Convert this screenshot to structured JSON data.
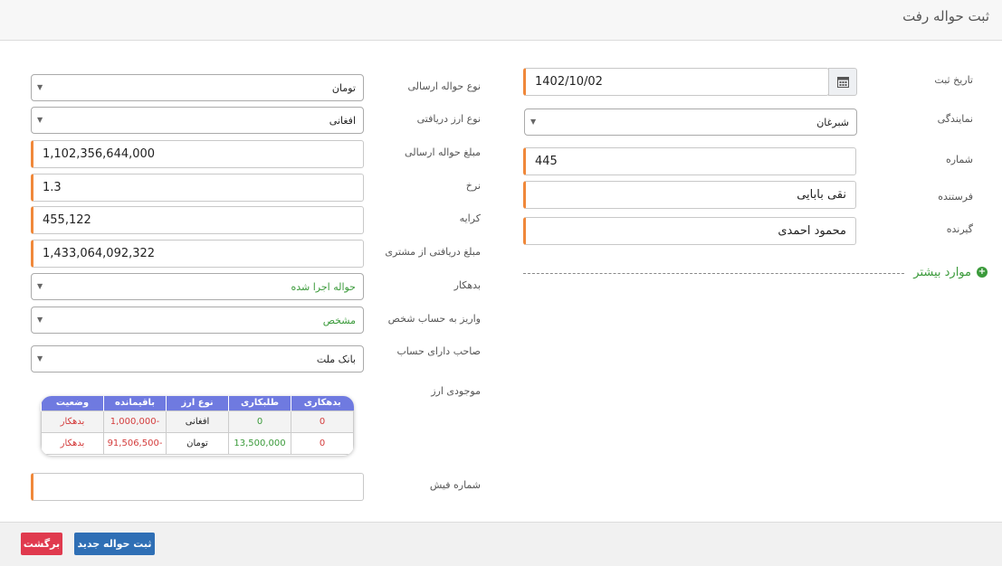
{
  "header": {
    "title": "ثبت حواله رفت"
  },
  "right_form": {
    "reg_date": {
      "label": "تاریخ ثبت",
      "value": "1402/10/02"
    },
    "agency": {
      "label": "نمایندگی",
      "value": "شبرغان"
    },
    "number": {
      "label": "شماره",
      "value": "445"
    },
    "sender": {
      "label": "فرستنده",
      "value": "نقی بابایی"
    },
    "receiver": {
      "label": "گیرنده",
      "value": "محمود احمدی"
    },
    "more_label": "موارد بیشتر"
  },
  "left_form": {
    "send_type": {
      "label": "نوع حواله ارسالی",
      "value": "تومان"
    },
    "recv_currency": {
      "label": "نوع ارز دریافتی",
      "value": "افغانی"
    },
    "send_amount": {
      "label": "مبلغ حواله ارسالی",
      "value": "1,102,356,644,000"
    },
    "rate": {
      "label": "نرخ",
      "value": "1.3"
    },
    "fee": {
      "label": "کرایه",
      "value": "455,122"
    },
    "customer_amount": {
      "label": "مبلغ دریافتی از مشتری",
      "value": "1,433,064,092,322"
    },
    "debtor": {
      "label": "بدهکار",
      "value": "حواله اجرا شده"
    },
    "deposit": {
      "label": "واریز به حساب شخص",
      "value": "مشخص"
    },
    "account_owner": {
      "label": "صاحب دارای حساب",
      "value": "بانک ملت"
    },
    "balance_label": "موجودی ارز",
    "receipt": {
      "label": "شماره فیش",
      "value": ""
    }
  },
  "balance_table": {
    "headers": [
      "بدهکاری",
      "طلبکاری",
      "نوع ارز",
      "باقیمانده",
      "وضعیت"
    ],
    "rows": [
      [
        "0",
        "0",
        "افغانی",
        "-1,000,000",
        "بدهکار"
      ],
      [
        "0",
        "13,500,000",
        "تومان",
        "-91,506,500",
        "بدهکار"
      ]
    ]
  },
  "footer": {
    "save_label": "ثبت حواله جدید",
    "back_label": "برگشت"
  },
  "colors": {
    "accent_required": "#f0883a",
    "table_header": "#6f7ae0",
    "save": "#2f6fb5",
    "back": "#e03a4e",
    "green": "#3a9a3a",
    "red": "#d43c3c"
  }
}
